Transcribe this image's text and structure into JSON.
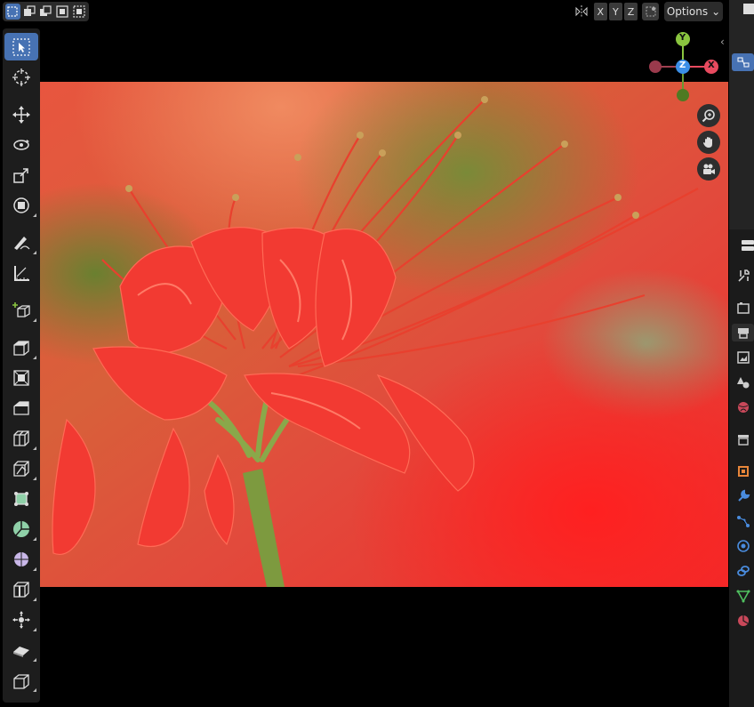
{
  "header": {
    "select_modes": [
      "select-new",
      "select-extend",
      "select-subtract",
      "select-invert",
      "select-intersect"
    ],
    "axes": [
      "X",
      "Y",
      "Z"
    ],
    "options_label": "Options",
    "options_chevron": "⌄"
  },
  "toolbar": {
    "tools": [
      "select-box",
      "cursor",
      "move",
      "rotate",
      "scale",
      "transform",
      "annotate",
      "measure",
      "add-cube",
      "extrude",
      "inset",
      "bevel",
      "loop-cut",
      "knife",
      "poly-build",
      "spin",
      "smooth",
      "edge-slide",
      "shrink-fatten",
      "shear",
      "rip"
    ]
  },
  "gizmo": {
    "x_label": "X",
    "y_label": "Y",
    "z_label": "Z",
    "colors": {
      "x": "#e84a5f",
      "y": "#8ac53f",
      "z": "#3b8fe8"
    }
  },
  "viewport": {
    "image_subject": "red-spider-lily-photo"
  },
  "properties_tabs": [
    "tool",
    "render",
    "output",
    "view-layer",
    "scene",
    "world",
    "collection",
    "object",
    "modifiers",
    "particles",
    "physics",
    "constraints",
    "data",
    "material"
  ]
}
